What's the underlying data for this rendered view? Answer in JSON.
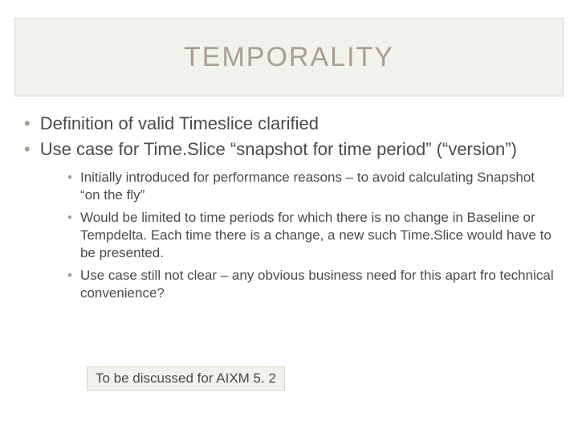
{
  "title": "TEMPORALITY",
  "bullets": {
    "lvl1": [
      "Definition of valid Timeslice clarified",
      "Use case for Time.Slice “snapshot for time period” (“version”)"
    ],
    "lvl2": [
      "Initially introduced for performance reasons – to avoid calculating Snapshot “on the fly”",
      "Would be limited to time periods for which there is no change in Baseline or Tempdelta. Each time there is a change, a new such Time.Slice would have to be presented.",
      "Use case still not clear – any obvious business need for this apart fro technical convenience?"
    ]
  },
  "callout": "To be discussed for AIXM 5. 2"
}
